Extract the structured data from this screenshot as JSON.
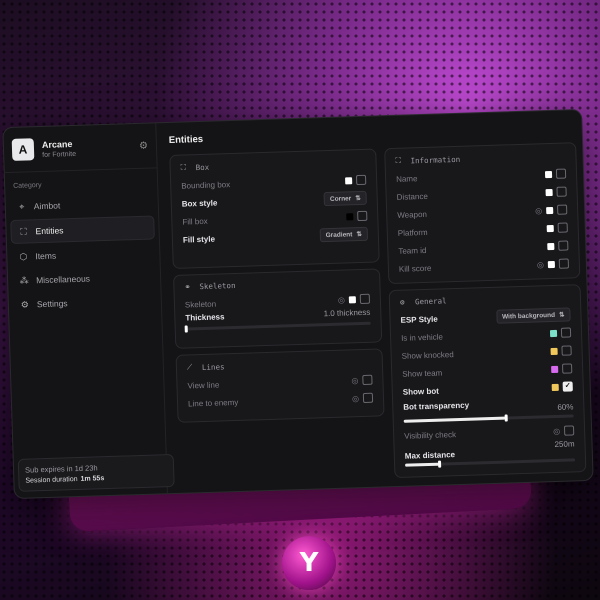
{
  "sidebar": {
    "brand_initial": "A",
    "brand_name": "Arcane",
    "brand_sub": "for Fortnite",
    "category_label": "Category",
    "items": [
      {
        "label": "Aimbot",
        "icon": "aim-icon"
      },
      {
        "label": "Entities",
        "icon": "entities-icon",
        "active": true
      },
      {
        "label": "Items",
        "icon": "cube-icon"
      },
      {
        "label": "Miscellaneous",
        "icon": "misc-icon"
      },
      {
        "label": "Settings",
        "icon": "gear-icon"
      }
    ],
    "sub_line": "Sub expires in 1d 23h",
    "session_label": "Session duration",
    "session_value": "1m 55s"
  },
  "main": {
    "title": "Entities",
    "box": {
      "title": "Box",
      "bounding_box": "Bounding box",
      "box_style": "Box style",
      "box_style_value": "Corner",
      "fill_box": "Fill box",
      "fill_style": "Fill style",
      "fill_style_value": "Gradient"
    },
    "skeleton": {
      "title": "Skeleton",
      "skeleton": "Skeleton",
      "thickness": "Thickness",
      "thickness_value": "1.0 thickness",
      "thickness_level": 0.0
    },
    "lines": {
      "title": "Lines",
      "view_line": "View line",
      "line_to_enemy": "Line to enemy"
    },
    "information": {
      "title": "Information",
      "name": "Name",
      "distance": "Distance",
      "weapon": "Weapon",
      "platform": "Platform",
      "team_id": "Team id",
      "kill_score": "Kill score"
    },
    "general": {
      "title": "General",
      "esp_style": "ESP Style",
      "esp_style_value": "With background",
      "is_in_vehicle": "Is in vehicle",
      "show_knocked": "Show knocked",
      "show_team": "Show team",
      "show_bot": "Show bot",
      "bot_transparency": "Bot transparency",
      "bot_transparency_value": "60%",
      "bot_transparency_level": 0.6,
      "visibility_check": "Visibility check",
      "max_distance": "Max distance",
      "max_distance_value": "250m",
      "max_distance_level": 0.2
    }
  },
  "colors": {
    "vehicle": "#7de0c8",
    "knocked": "#f0c75a",
    "team": "#d86af0",
    "bot": "#f0c75a"
  },
  "footer_logo": "Y"
}
